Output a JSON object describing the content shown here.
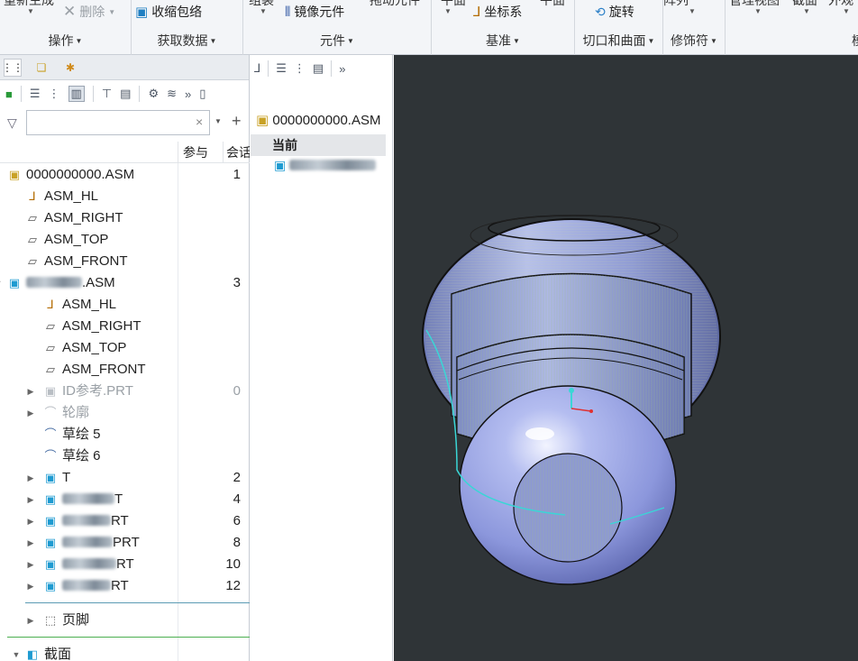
{
  "ribbon": {
    "groups": [
      {
        "label": "操作",
        "clipped_top": "重新生成",
        "buttons": [
          {
            "label": "删除",
            "icon": "close-x-icon",
            "disabled": true
          }
        ]
      },
      {
        "label": "获取数据",
        "buttons": [
          {
            "label": "收缩包络",
            "icon": "shrinkwrap-icon"
          }
        ]
      },
      {
        "label": "元件",
        "clipped_top": "组装",
        "clipped_top_right": "拖动元件",
        "buttons": [
          {
            "label": "镜像元件",
            "icon": "mirror-component-icon"
          }
        ]
      },
      {
        "label": "基准",
        "clipped_top": "平面",
        "clipped_top_right": "平面",
        "buttons": [
          {
            "label": "坐标系",
            "icon": "coordinate-system-icon"
          }
        ]
      },
      {
        "label": "切口和曲面",
        "buttons": [
          {
            "label": "旋转",
            "icon": "revolve-icon"
          }
        ]
      },
      {
        "label": "修饰符",
        "clipped_top": "阵列"
      },
      {
        "label": "",
        "clipped_top": "管理视图",
        "clipped_top_2": "截面",
        "clipped_top_3": "外观"
      },
      {
        "label": "模",
        "clipped_top": ""
      }
    ]
  },
  "left_panel": {
    "tabs": [
      {
        "name": "model-tree"
      },
      {
        "name": "folder-browser"
      },
      {
        "name": "favorites"
      }
    ],
    "filter": {
      "value": "",
      "placeholder": ""
    },
    "columns": [
      "参与",
      "会话"
    ],
    "rows": [
      {
        "label": "0000000000.ASM",
        "num": "1",
        "icon": "assembly-icon"
      },
      {
        "label": "ASM_HL",
        "num": "",
        "icon": "csys-icon"
      },
      {
        "label": "ASM_RIGHT",
        "num": "",
        "icon": "datum-plane-icon"
      },
      {
        "label": "ASM_TOP",
        "num": "",
        "icon": "datum-plane-icon"
      },
      {
        "label": "ASM_FRONT",
        "num": "",
        "icon": "datum-plane-icon"
      },
      {
        "label": ".ASM",
        "num": "3",
        "icon": "assembly-icon",
        "blurred": true,
        "expander": "open"
      },
      {
        "label": "ASM_HL",
        "num": "",
        "icon": "csys-icon"
      },
      {
        "label": "ASM_RIGHT",
        "num": "",
        "icon": "datum-plane-icon"
      },
      {
        "label": "ASM_TOP",
        "num": "",
        "icon": "datum-plane-icon"
      },
      {
        "label": "ASM_FRONT",
        "num": "",
        "icon": "datum-plane-icon"
      },
      {
        "label": "ID参考.PRT",
        "num": "0",
        "icon": "part-icon",
        "dim": true,
        "expander": "closed"
      },
      {
        "label": "轮廓",
        "num": "",
        "icon": "sketch-icon",
        "dim": true,
        "expander": "closed"
      },
      {
        "label": "草绘 5",
        "num": "",
        "icon": "sketch-icon"
      },
      {
        "label": "草绘 6",
        "num": "",
        "icon": "sketch-icon"
      },
      {
        "label": "T",
        "num": "2",
        "icon": "part-icon",
        "blurred": true,
        "expander": "closed"
      },
      {
        "label": "T",
        "num": "4",
        "icon": "part-icon",
        "blurred": true,
        "expander": "closed"
      },
      {
        "label": "RT",
        "num": "6",
        "icon": "part-icon",
        "blurred": true,
        "expander": "closed"
      },
      {
        "label": "PRT",
        "num": "8",
        "icon": "part-icon",
        "blurred": true,
        "expander": "closed"
      },
      {
        "label": "RT",
        "num": "10",
        "icon": "part-icon",
        "blurred": true,
        "expander": "closed"
      },
      {
        "label": "RT",
        "num": "12",
        "icon": "part-icon",
        "blurred": true,
        "expander": "closed"
      },
      {
        "label": "页脚",
        "num": "",
        "icon": "footer-icon",
        "expander": "closed"
      },
      {
        "label": "截面",
        "num": "",
        "icon": "section-icon",
        "expander": "open"
      }
    ]
  },
  "mid_panel": {
    "root_label": "0000000000.ASM",
    "current_label": "当前",
    "child_label": ""
  },
  "colors": {
    "viewport_bg": "#2f3437",
    "model_fill": "#8e9ad6",
    "edge": "#1c1c1c",
    "axis_cyan": "#3ad6d6",
    "axis_red": "#e03030"
  }
}
